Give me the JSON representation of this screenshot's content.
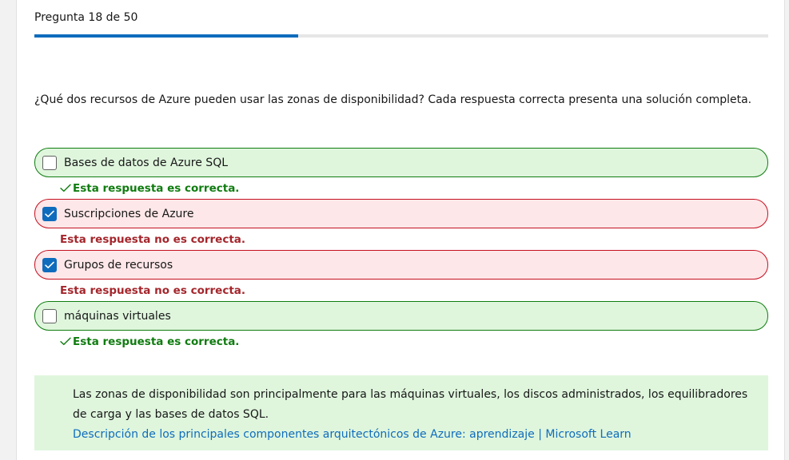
{
  "header": {
    "counter": "Pregunta 18 de 50",
    "progress": 0.36
  },
  "question": {
    "text": "¿Qué dos recursos de Azure pueden usar las zonas de disponibilidad? Cada respuesta correcta presenta una solución completa."
  },
  "options": [
    {
      "label": "Bases de datos de Azure SQL",
      "checked": false,
      "status": "correct",
      "feedback": "Esta respuesta es correcta."
    },
    {
      "label": "Suscripciones de Azure",
      "checked": true,
      "status": "incorrect",
      "feedback": "Esta respuesta no es correcta."
    },
    {
      "label": "Grupos de recursos",
      "checked": true,
      "status": "incorrect",
      "feedback": "Esta respuesta no es correcta."
    },
    {
      "label": "máquinas virtuales",
      "checked": false,
      "status": "correct",
      "feedback": "Esta respuesta es correcta."
    }
  ],
  "explanation": {
    "text": "Las zonas de disponibilidad son principalmente para las máquinas virtuales, los discos administrados, los equilibradores de carga y las bases de datos SQL.",
    "link_text": "Descripción de los principales componentes arquitectónicos de Azure: aprendizaje | Microsoft Learn"
  },
  "colors": {
    "accent": "#0f6cbd",
    "correct": "#107c10",
    "incorrect": "#c50f1f",
    "correct_bg": "#dff6dd",
    "incorrect_bg": "#fde7e9"
  },
  "icons": {
    "checkbox_checked": "checkmark-icon",
    "feedback_correct": "checkmark-icon"
  }
}
